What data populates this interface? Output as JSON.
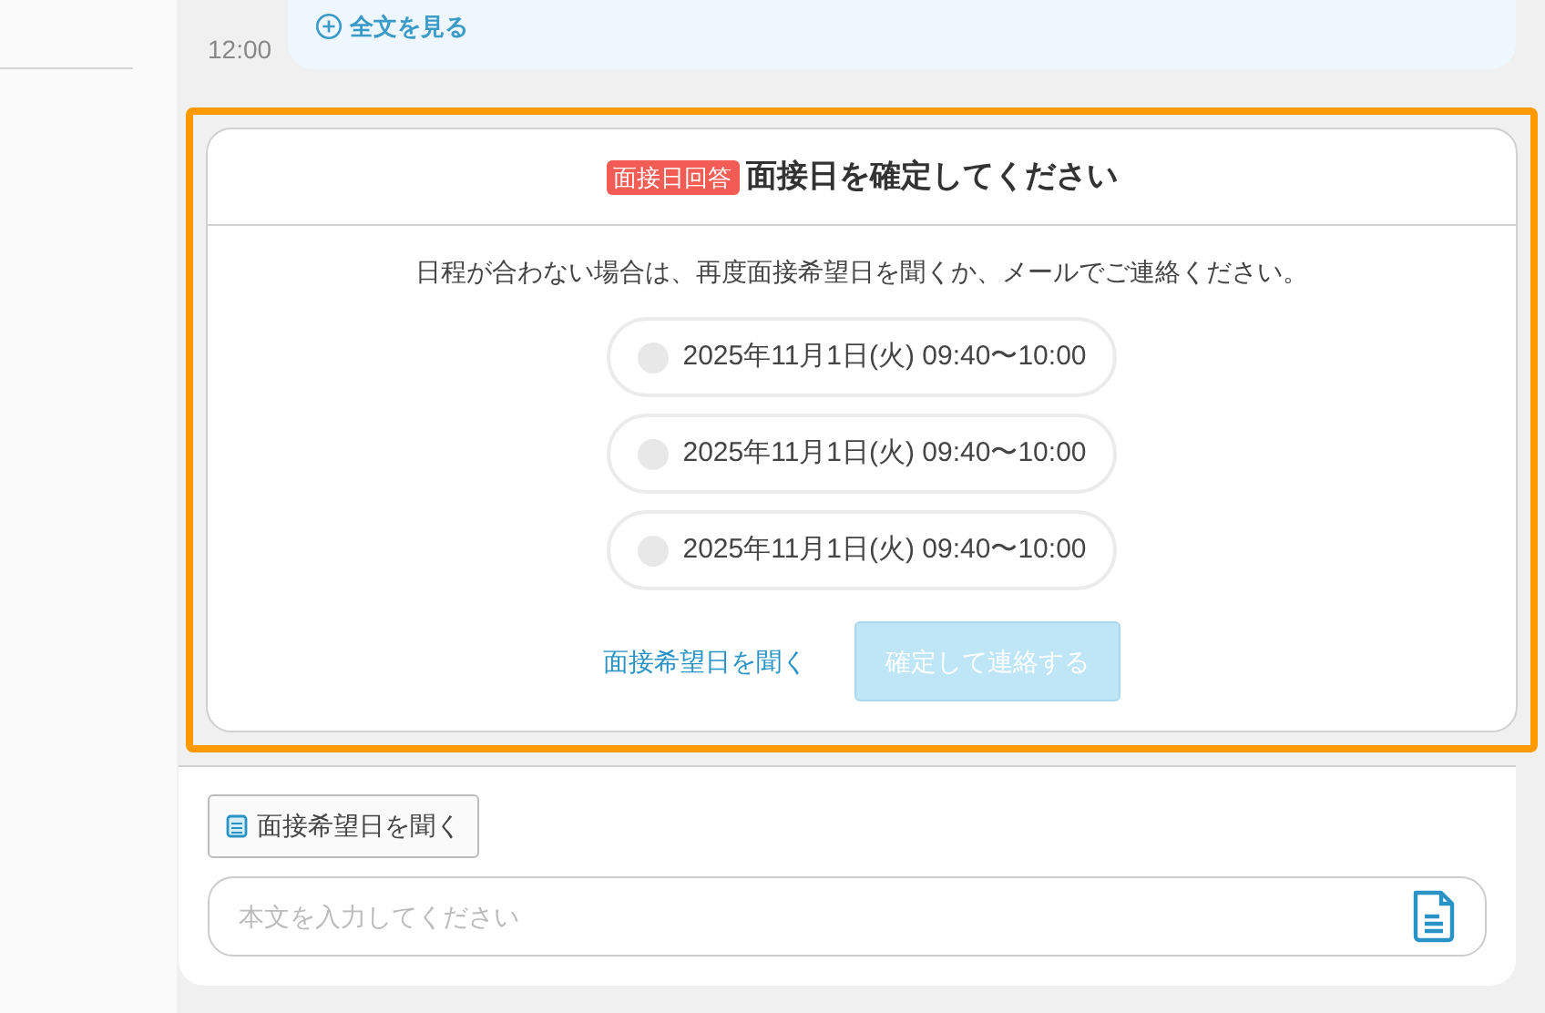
{
  "message": {
    "link": "全文を見る",
    "time": "12:00"
  },
  "card": {
    "badge": "面接日回答",
    "title": "面接日を確定してください",
    "note": "日程が合わない場合は、再度面接希望日を聞くか、メールでご連絡ください。",
    "options": [
      {
        "label": "2025年11月1日(火) 09:40〜10:00",
        "selected": false
      },
      {
        "label": "2025年11月1日(火) 09:40〜10:00",
        "selected": false
      },
      {
        "label": "2025年11月1日(火) 09:40〜10:00",
        "selected": false
      }
    ],
    "ask_link": "面接希望日を聞く",
    "confirm": {
      "label": "確定して連絡する",
      "disabled": true
    }
  },
  "composer": {
    "ask_button": "面接希望日を聞く",
    "placeholder": "本文を入力してください"
  }
}
